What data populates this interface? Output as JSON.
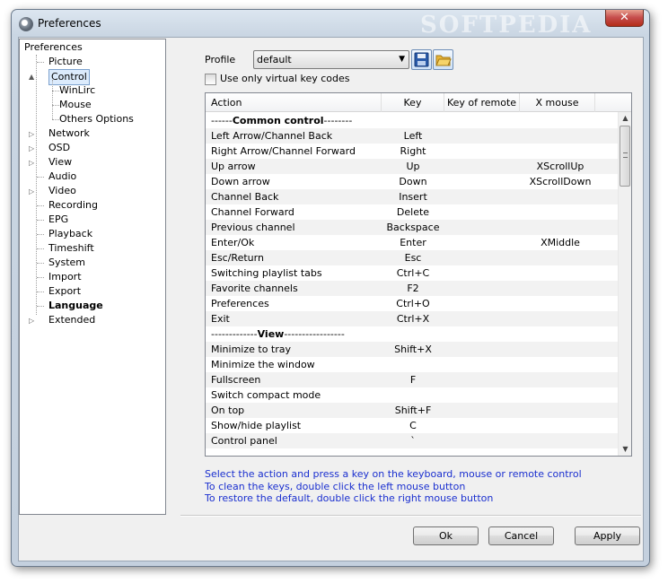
{
  "window": {
    "title": "Preferences",
    "watermark": "SOFTPEDIA",
    "close_label": "✕"
  },
  "tree": {
    "root": "Preferences",
    "items": [
      {
        "label": "Picture",
        "expander": "",
        "selected": false,
        "bold": false
      },
      {
        "label": "Control",
        "expander": "▲",
        "selected": true,
        "bold": false,
        "children": [
          "WinLirc",
          "Mouse",
          "Others Options"
        ]
      },
      {
        "label": "Network",
        "expander": "▷"
      },
      {
        "label": "OSD",
        "expander": "▷"
      },
      {
        "label": "View",
        "expander": "▷"
      },
      {
        "label": "Audio",
        "expander": ""
      },
      {
        "label": "Video",
        "expander": "▷"
      },
      {
        "label": "Recording",
        "expander": ""
      },
      {
        "label": "EPG",
        "expander": ""
      },
      {
        "label": "Playback",
        "expander": ""
      },
      {
        "label": "Timeshift",
        "expander": ""
      },
      {
        "label": "System",
        "expander": ""
      },
      {
        "label": "Import",
        "expander": ""
      },
      {
        "label": "Export",
        "expander": ""
      },
      {
        "label": "Language",
        "expander": "",
        "bold": true
      },
      {
        "label": "Extended",
        "expander": "▷"
      }
    ]
  },
  "profile": {
    "label": "Profile",
    "value": "default",
    "arrow": "▼"
  },
  "checkbox": {
    "label": "Use only virtual key codes",
    "checked": false
  },
  "table": {
    "headers": {
      "action": "Action",
      "key": "Key",
      "remote": "Key of remote",
      "mouse": "X mouse"
    },
    "rows": [
      {
        "action": "------Common control--------",
        "bold": "Common control",
        "pre": "------",
        "post": "--------",
        "section": true,
        "key": "",
        "remote": "",
        "mouse": ""
      },
      {
        "action": "Left Arrow/Channel Back",
        "key": "Left",
        "remote": "",
        "mouse": ""
      },
      {
        "action": "Right Arrow/Channel Forward",
        "key": "Right",
        "remote": "",
        "mouse": ""
      },
      {
        "action": "Up arrow",
        "key": "Up",
        "remote": "",
        "mouse": "XScrollUp"
      },
      {
        "action": "Down arrow",
        "key": "Down",
        "remote": "",
        "mouse": "XScrollDown"
      },
      {
        "action": "Channel Back",
        "key": "Insert",
        "remote": "",
        "mouse": ""
      },
      {
        "action": "Channel Forward",
        "key": "Delete",
        "remote": "",
        "mouse": ""
      },
      {
        "action": "Previous channel",
        "key": "Backspace",
        "remote": "",
        "mouse": ""
      },
      {
        "action": "Enter/Ok",
        "key": "Enter",
        "remote": "",
        "mouse": "XMiddle"
      },
      {
        "action": "Esc/Return",
        "key": "Esc",
        "remote": "",
        "mouse": ""
      },
      {
        "action": "Switching playlist tabs",
        "key": "Ctrl+C",
        "remote": "",
        "mouse": ""
      },
      {
        "action": "Favorite channels",
        "key": "F2",
        "remote": "",
        "mouse": ""
      },
      {
        "action": "Preferences",
        "key": "Ctrl+O",
        "remote": "",
        "mouse": ""
      },
      {
        "action": "Exit",
        "key": "Ctrl+X",
        "remote": "",
        "mouse": ""
      },
      {
        "action": "-------------View-----------------",
        "bold": "View",
        "pre": "-------------",
        "post": "-----------------",
        "section": true,
        "key": "",
        "remote": "",
        "mouse": ""
      },
      {
        "action": "Minimize to tray",
        "key": "Shift+X",
        "remote": "",
        "mouse": ""
      },
      {
        "action": "Minimize the window",
        "key": "",
        "remote": "",
        "mouse": ""
      },
      {
        "action": "Fullscreen",
        "key": "F",
        "remote": "",
        "mouse": ""
      },
      {
        "action": "Switch compact mode",
        "key": "",
        "remote": "",
        "mouse": ""
      },
      {
        "action": "On top",
        "key": "Shift+F",
        "remote": "",
        "mouse": ""
      },
      {
        "action": "Show/hide playlist",
        "key": "C",
        "remote": "",
        "mouse": ""
      },
      {
        "action": "Control panel",
        "key": "`",
        "remote": "",
        "mouse": ""
      }
    ]
  },
  "hints": [
    "Select the action and press a key on the keyboard, mouse or remote control",
    "To clean the keys, double click the left mouse button",
    "To restore the default, double click the right mouse button"
  ],
  "buttons": {
    "ok": "Ok",
    "cancel": "Cancel",
    "apply": "Apply"
  },
  "colors": {
    "hint_text": "#1a2fcf",
    "selection": "#dcebfc"
  }
}
